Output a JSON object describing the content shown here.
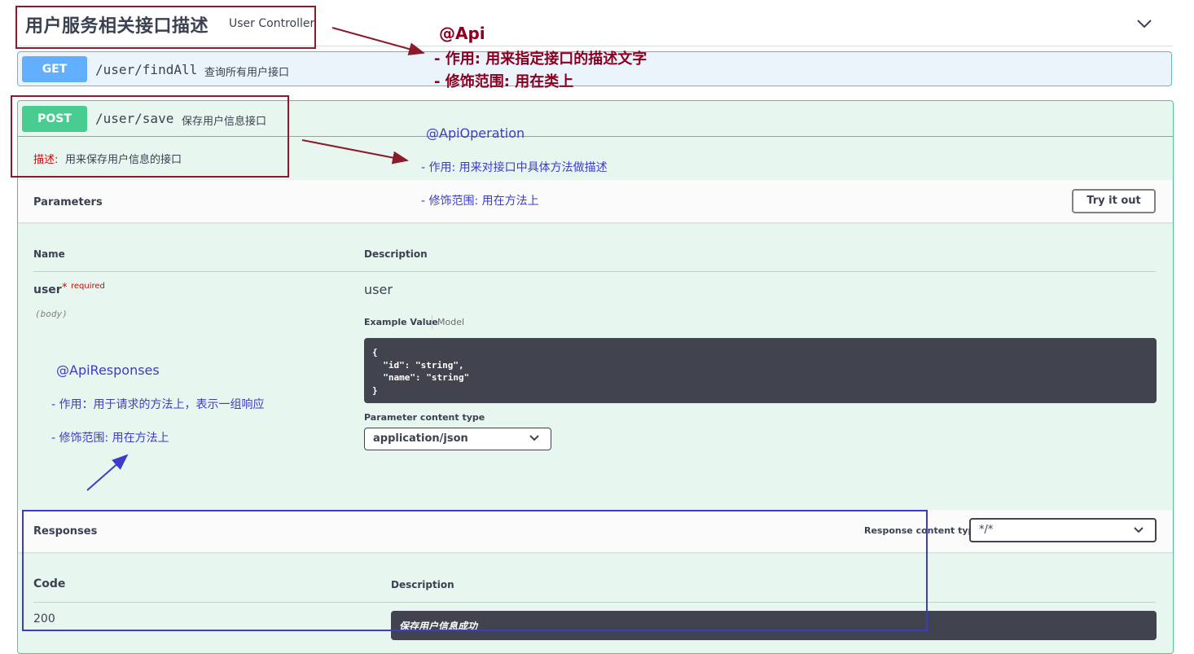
{
  "tag": {
    "title": "用户服务相关接口描述",
    "description": "User Controller",
    "icon": "chevron-down-icon"
  },
  "get_op": {
    "method": "GET",
    "path": "/user/findAll",
    "summary": "查询所有用户接口",
    "color": "#61affe"
  },
  "post_op": {
    "method": "POST",
    "path": "/user/save",
    "summary": "保存用户信息接口",
    "color": "#49cc90",
    "description_label": "描述:",
    "description": "用来保存用户信息的接口"
  },
  "parameters": {
    "title": "Parameters",
    "try_button": "Try it out",
    "col_name": "Name",
    "col_description": "Description",
    "param": {
      "name": "user",
      "star": "*",
      "required": "required",
      "in": "(body)",
      "description": "user"
    },
    "example_tab": "Example Value",
    "model_tab": "Model",
    "example_code": "{\n  \"id\": \"string\",\n  \"name\": \"string\"\n}",
    "content_type_label": "Parameter content type",
    "content_type_value": "application/json"
  },
  "responses": {
    "title": "Responses",
    "content_type_label": "Response content type",
    "content_type_value": "*/*",
    "col_code": "Code",
    "col_description": "Description",
    "row": {
      "code": "200",
      "description": "保存用户信息成功"
    }
  },
  "annotations": {
    "api": {
      "title": "@Api",
      "line1": "- 作用: 用来指定接口的描述文字",
      "line2": "- 修饰范围: 用在类上",
      "color": "#8b0020"
    },
    "api_operation": {
      "title": "@ApiOperation",
      "line1": "- 作用: 用来对接口中具体方法做描述",
      "line2": "- 修饰范围: 用在方法上",
      "color": "#3c3cc8"
    },
    "api_responses": {
      "title": "@ApiResponses",
      "line1": "- 作用：用于请求的方法上，表示一组响应",
      "line2": "- 修饰范围: 用在方法上",
      "color": "#3c3cc8"
    }
  }
}
